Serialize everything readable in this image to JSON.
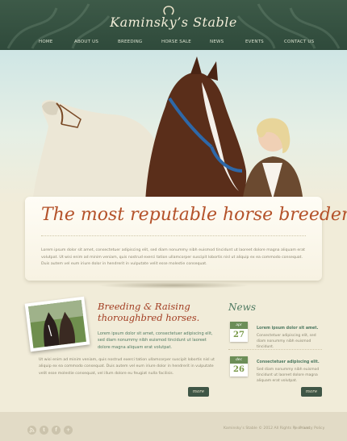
{
  "brand": {
    "title": "Kaminsky’s Stable"
  },
  "nav": {
    "items": [
      "HOME",
      "ABOUT US",
      "BREEDING",
      "HORSE SALE",
      "NEWS",
      "EVENTS",
      "CONTACT US"
    ]
  },
  "hero": {
    "tagline": "The most reputable horse breeder.",
    "text": "Lorem ipsum dolor sit amet, consectetuer adipiscing elit, sed diam nonummy nibh euismod tincidunt ut laoreet dolore magna aliquam erat volutpat. Ut wisi enim ad minim veniam, quis nostrud exerci tation ullamcorper suscipit lobortis nisl ut aliquip ex ea commodo consequat. Duis autem vel eum iriure dolor in hendrerit in vulputate velit esse molestie consequat."
  },
  "breeding": {
    "title_line1": "Breeding & Raising",
    "title_line2": "thoroughbred horses.",
    "intro": "Lorem ipsum dolor sit amet, consectetuer adipiscing elit, sed diam nonummy nibh euismod tincidunt ut laoreet dolore magna aliquam erat volutpat.",
    "text": "Ut wisi enim ad minim veniam, quis nostrud exerci tation ullamcorper suscipit lobortis nisl ut aliquip ex ea commodo consequat. Duis autem vel eum iriure dolor in hendrerit in vulputate velit esse molestie consequat, vel illum dolore eu feugiat nulla facilisis.",
    "more_label": "more"
  },
  "news": {
    "title": "News",
    "items": [
      {
        "month": "apr",
        "day": "27",
        "heading": "Lorem ipsum dolor sit amet.",
        "text": "Consectetuer adipiscing elit, sed diam nonummy nibh euismod tincidunt."
      },
      {
        "month": "dec",
        "day": "26",
        "heading": "Consectetuer adipiscing elit.",
        "text": "Sed diam nonummy nibh euismod tincidunt ut laoreet dolore magna aliquam erat volutpat."
      }
    ],
    "more_label": "more"
  },
  "footer": {
    "copyright": "Kaminsky’s Stable © 2012 All Rights Reserved",
    "separator": "|",
    "privacy": "Privacy Policy",
    "social": [
      "rss-icon",
      "twitter-icon",
      "facebook-icon",
      "plus-icon"
    ]
  },
  "colors": {
    "header": "#2f4a3b",
    "accent": "#b4522a",
    "green": "#4f7a62",
    "background": "#f1ecd9"
  }
}
